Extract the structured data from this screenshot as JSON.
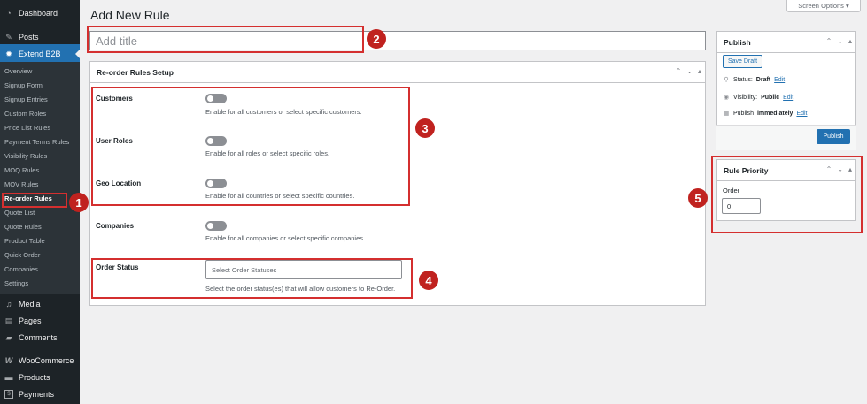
{
  "sidebar": {
    "top_items": [
      {
        "label": "Dashboard",
        "icon": "dashboard-icon"
      },
      {
        "label": "Posts",
        "icon": "pin-icon"
      },
      {
        "label": "Extend B2B",
        "icon": "gear-icon"
      }
    ],
    "submenu": [
      "Overview",
      "Signup Form",
      "Signup Entries",
      "Custom Roles",
      "Price List Rules",
      "Payment Terms Rules",
      "Visibility Rules",
      "MOQ Rules",
      "MOV Rules",
      "Re-order Rules",
      "Quote List",
      "Quote Rules",
      "Product Table",
      "Quick Order",
      "Companies",
      "Settings"
    ],
    "bottom_items": [
      {
        "label": "Media",
        "icon": "media-icon"
      },
      {
        "label": "Pages",
        "icon": "pages-icon"
      },
      {
        "label": "Comments",
        "icon": "comments-icon"
      },
      {
        "label": "WooCommerce",
        "icon": "woocommerce-icon"
      },
      {
        "label": "Products",
        "icon": "products-icon"
      },
      {
        "label": "Payments",
        "icon": "payments-icon"
      }
    ]
  },
  "header": {
    "title": "Add New Rule",
    "screen_options": "Screen Options ▾"
  },
  "title_field": {
    "placeholder": "Add title"
  },
  "setup": {
    "title": "Re-order Rules Setup",
    "customers": {
      "label": "Customers",
      "desc": "Enable for all customers or select specific customers."
    },
    "user_roles": {
      "label": "User Roles",
      "desc": "Enable for all roles or select specific roles."
    },
    "geo_location": {
      "label": "Geo Location",
      "desc": "Enable for all countries or select specific countries."
    },
    "companies": {
      "label": "Companies",
      "desc": "Enable for all companies or select specific companies."
    },
    "order_status": {
      "label": "Order Status",
      "placeholder": "Select Order Statuses",
      "desc": "Select the order status(es) that will allow customers to Re-Order."
    }
  },
  "publish": {
    "title": "Publish",
    "save_draft": "Save Draft",
    "status_label": "Status:",
    "status_value": "Draft",
    "visibility_label": "Visibility:",
    "visibility_value": "Public",
    "publish_label": "Publish",
    "publish_value": "immediately",
    "edit": "Edit",
    "publish_button": "Publish"
  },
  "priority": {
    "title": "Rule Priority",
    "order_label": "Order",
    "order_value": "0"
  },
  "controls": {
    "up": "⌃",
    "down": "⌄",
    "toggle": "▴"
  },
  "annotations": [
    "1",
    "2",
    "3",
    "4",
    "5"
  ],
  "colors": {
    "accent": "#2271b1",
    "annotation": "#c0221f",
    "sidebar": "#1d2327"
  }
}
